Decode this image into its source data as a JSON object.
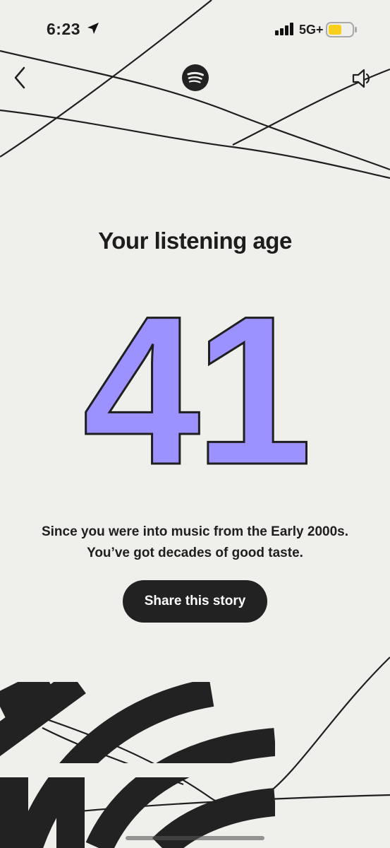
{
  "status_bar": {
    "time": "6:23",
    "network": "5G+",
    "battery_color": "#f7cf1c"
  },
  "header": {
    "back_icon": "chevron-left-icon",
    "logo_icon": "spotify-logo-icon",
    "sound_icon": "speaker-icon"
  },
  "story": {
    "headline": "Your listening age",
    "age": "41",
    "caption_line1": "Since you were into music from the Early 2000s.",
    "caption_line2": "You’ve got decades of good taste.",
    "share_label": "Share this story"
  },
  "colors": {
    "background": "#efefeb",
    "number_fill": "#9b92ff",
    "ink": "#222222"
  }
}
